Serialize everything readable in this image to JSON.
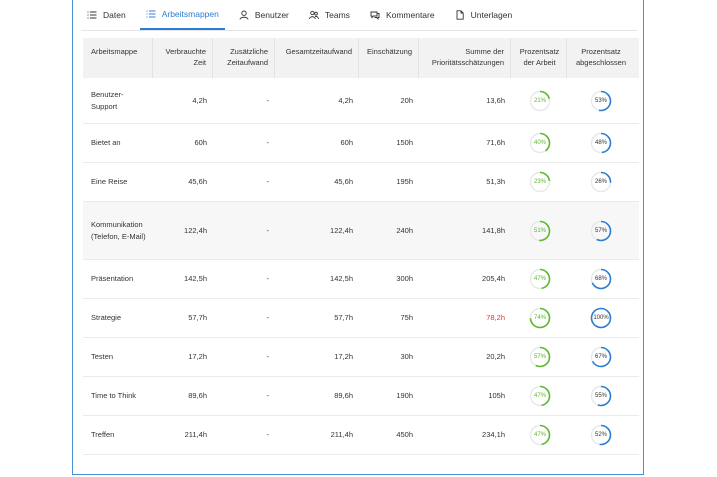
{
  "tabs": [
    {
      "label": "Daten",
      "icon": "list-icon",
      "active": false
    },
    {
      "label": "Arbeitsmappen",
      "icon": "list-icon",
      "active": true
    },
    {
      "label": "Benutzer",
      "icon": "user-icon",
      "active": false
    },
    {
      "label": "Teams",
      "icon": "team-icon",
      "active": false
    },
    {
      "label": "Kommentare",
      "icon": "comment-icon",
      "active": false
    },
    {
      "label": "Unterlagen",
      "icon": "document-icon",
      "active": false
    }
  ],
  "columns": {
    "name": "Arbeitsmappe",
    "used": "Verbrauchte Zeit",
    "extra": "Zusätzliche Zeitaufwand",
    "total": "Gesamtzeitaufwand",
    "estimate": "Einschätzung",
    "priority": "Summe der Prioritätsschätzungen",
    "work_pct": "Prozentsatz der Arbeit",
    "done_pct": "Prozentsatz abgeschlossen"
  },
  "colors": {
    "accent": "#2b7cd3",
    "work_ring": "#5cb82e",
    "done_ring": "#2b7cd3",
    "warning": "#e23b2e"
  },
  "rows": [
    {
      "name": "Benutzer-Support",
      "used": "4,2h",
      "extra": "-",
      "total": "4,2h",
      "estimate": "20h",
      "priority": "13,6h",
      "priority_warn": false,
      "work_pct": 21,
      "work_label": "21%",
      "done_pct": 53,
      "done_label": "53%",
      "highlight": false
    },
    {
      "name": "Bietet an",
      "used": "60h",
      "extra": "-",
      "total": "60h",
      "estimate": "150h",
      "priority": "71,6h",
      "priority_warn": false,
      "work_pct": 40,
      "work_label": "40%",
      "done_pct": 48,
      "done_label": "48%",
      "highlight": false
    },
    {
      "name": "Eine Reise",
      "used": "45,6h",
      "extra": "-",
      "total": "45,6h",
      "estimate": "195h",
      "priority": "51,3h",
      "priority_warn": false,
      "work_pct": 23,
      "work_label": "23%",
      "done_pct": 26,
      "done_label": "26%",
      "highlight": false
    },
    {
      "name": "Kommunikation (Telefon, E-Mail)",
      "used": "122,4h",
      "extra": "-",
      "total": "122,4h",
      "estimate": "240h",
      "priority": "141,8h",
      "priority_warn": false,
      "work_pct": 51,
      "work_label": "51%",
      "done_pct": 57,
      "done_label": "57%",
      "highlight": true
    },
    {
      "name": "Präsentation",
      "used": "142,5h",
      "extra": "-",
      "total": "142,5h",
      "estimate": "300h",
      "priority": "205,4h",
      "priority_warn": false,
      "work_pct": 47,
      "work_label": "47%",
      "done_pct": 68,
      "done_label": "68%",
      "highlight": false
    },
    {
      "name": "Strategie",
      "used": "57,7h",
      "extra": "-",
      "total": "57,7h",
      "estimate": "75h",
      "priority": "78,2h",
      "priority_warn": true,
      "work_pct": 74,
      "work_label": "74%",
      "done_pct": 100,
      "done_label": "100%",
      "highlight": false
    },
    {
      "name": "Testen",
      "used": "17,2h",
      "extra": "-",
      "total": "17,2h",
      "estimate": "30h",
      "priority": "20,2h",
      "priority_warn": false,
      "work_pct": 57,
      "work_label": "57%",
      "done_pct": 67,
      "done_label": "67%",
      "highlight": false
    },
    {
      "name": "Time to Think",
      "used": "89,6h",
      "extra": "-",
      "total": "89,6h",
      "estimate": "190h",
      "priority": "105h",
      "priority_warn": false,
      "work_pct": 47,
      "work_label": "47%",
      "done_pct": 55,
      "done_label": "55%",
      "highlight": false
    },
    {
      "name": "Treffen",
      "used": "211,4h",
      "extra": "-",
      "total": "211,4h",
      "estimate": "450h",
      "priority": "234,1h",
      "priority_warn": false,
      "work_pct": 47,
      "work_label": "47%",
      "done_pct": 52,
      "done_label": "52%",
      "highlight": false
    }
  ]
}
